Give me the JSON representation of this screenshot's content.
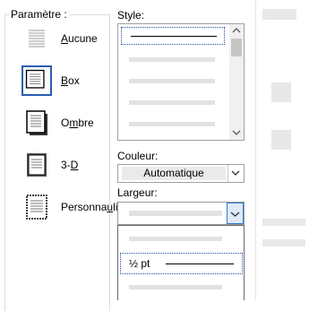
{
  "settings": {
    "group_label": "Paramètre :",
    "items": [
      {
        "label": "Aucune",
        "underline": "A",
        "rest": "ucune",
        "icon": "no-border-icon"
      },
      {
        "label": "Box",
        "underline": "B",
        "rest": "ox",
        "icon": "box-border-icon"
      },
      {
        "label": "Ombre",
        "underline": "m",
        "pre": "O",
        "rest": "bre",
        "icon": "shadow-border-icon"
      },
      {
        "label": "3-D",
        "underline": "D",
        "pre": "3-",
        "rest": "",
        "icon": "3d-border-icon"
      },
      {
        "label": "Personnaliser",
        "underline": "u",
        "pre": "Personna",
        "rest": "liser",
        "icon": "custom-border-icon"
      }
    ],
    "selected": "Box"
  },
  "style": {
    "label": "Style:"
  },
  "color": {
    "label": "Couleur:",
    "value": "Automatique"
  },
  "width": {
    "label": "Largeur:",
    "option_value": "½ pt"
  },
  "colors": {
    "accent": "#2a5db0",
    "selection_border": "#2a5db0",
    "dropdown_open_border": "#2a7ad0"
  }
}
